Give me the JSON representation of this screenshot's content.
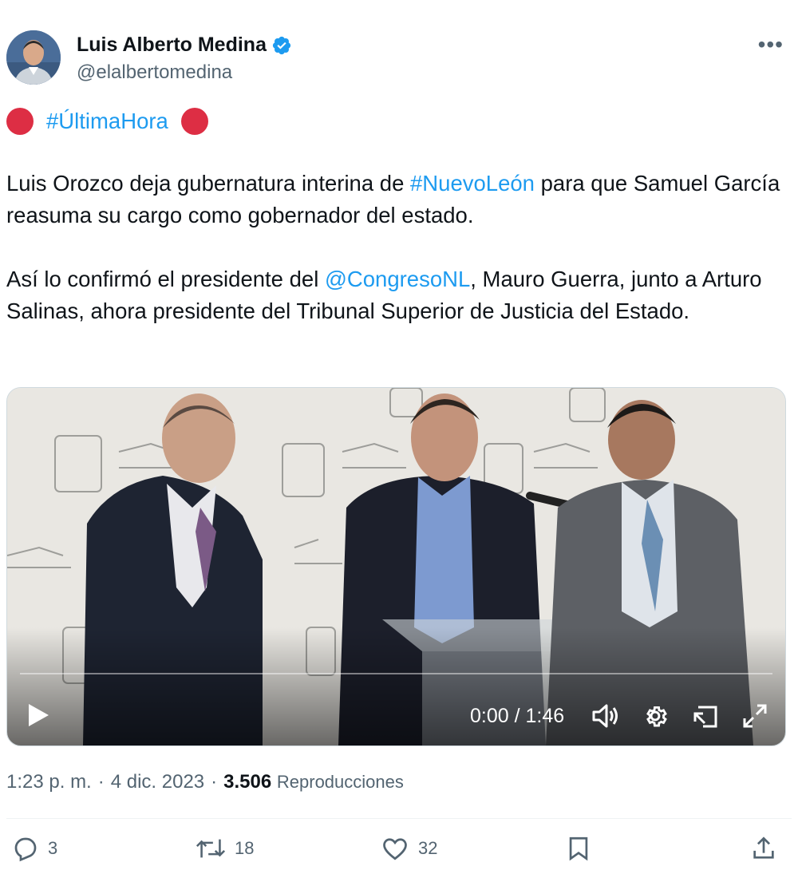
{
  "author": {
    "name": "Luis Alberto Medina",
    "handle": "@elalbertomedina",
    "verified": true
  },
  "tweet": {
    "hashtag": "#ÚltimaHora",
    "p1_pre": "Luis Orozco deja gubernatura interina de ",
    "p1_tag": "#NuevoLeón",
    "p1_post": " para que Samuel García reasuma su cargo como gobernador del estado.",
    "p2_pre": "Así lo confirmó el presidente del ",
    "p2_mention": "@CongresoNL",
    "p2_post": ", Mauro Guerra, junto a Arturo Salinas, ahora presidente del Tribunal Superior de Justicia del Estado."
  },
  "video": {
    "time": "0:00 / 1:46",
    "progress": 0
  },
  "meta": {
    "time": "1:23 p. m.",
    "sep1": "·",
    "date": "4 dic. 2023",
    "sep2": "·",
    "views_count": "3.506",
    "views_label": "Reproducciones"
  },
  "actions": {
    "replies": "3",
    "retweets": "18",
    "likes": "32"
  },
  "colors": {
    "link": "#1d9bf0",
    "verified": "#1d9bf0",
    "secondary_text": "#536471",
    "red_circle": "#dd2e44"
  }
}
